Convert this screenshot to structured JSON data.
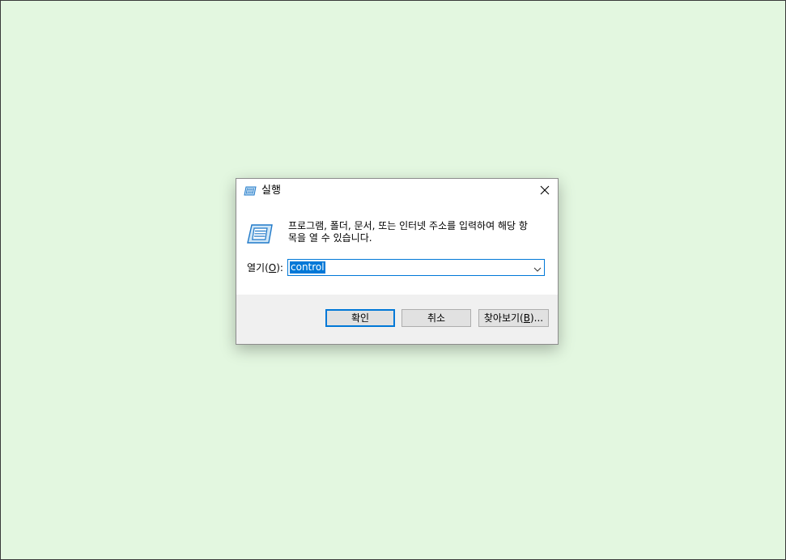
{
  "dialog": {
    "title": "실행",
    "close_icon": "close-icon",
    "app_icon": "run-icon",
    "description_line1": "프로그램, 폴더, 문서, 또는 인터넷 주소를 입력하여 해당 항",
    "description_line2": "목을 열 수 있습니다.",
    "open_label_prefix": "열기(",
    "open_label_key": "O",
    "open_label_suffix": "):",
    "open_value": "control",
    "buttons": {
      "ok": "확인",
      "cancel": "취소",
      "browse_prefix": "찾아보기(",
      "browse_key": "B",
      "browse_suffix": ")..."
    }
  },
  "colors": {
    "desktop_bg": "#e3f7e0",
    "accent": "#0078d7",
    "footer_bg": "#f0f0f0"
  }
}
